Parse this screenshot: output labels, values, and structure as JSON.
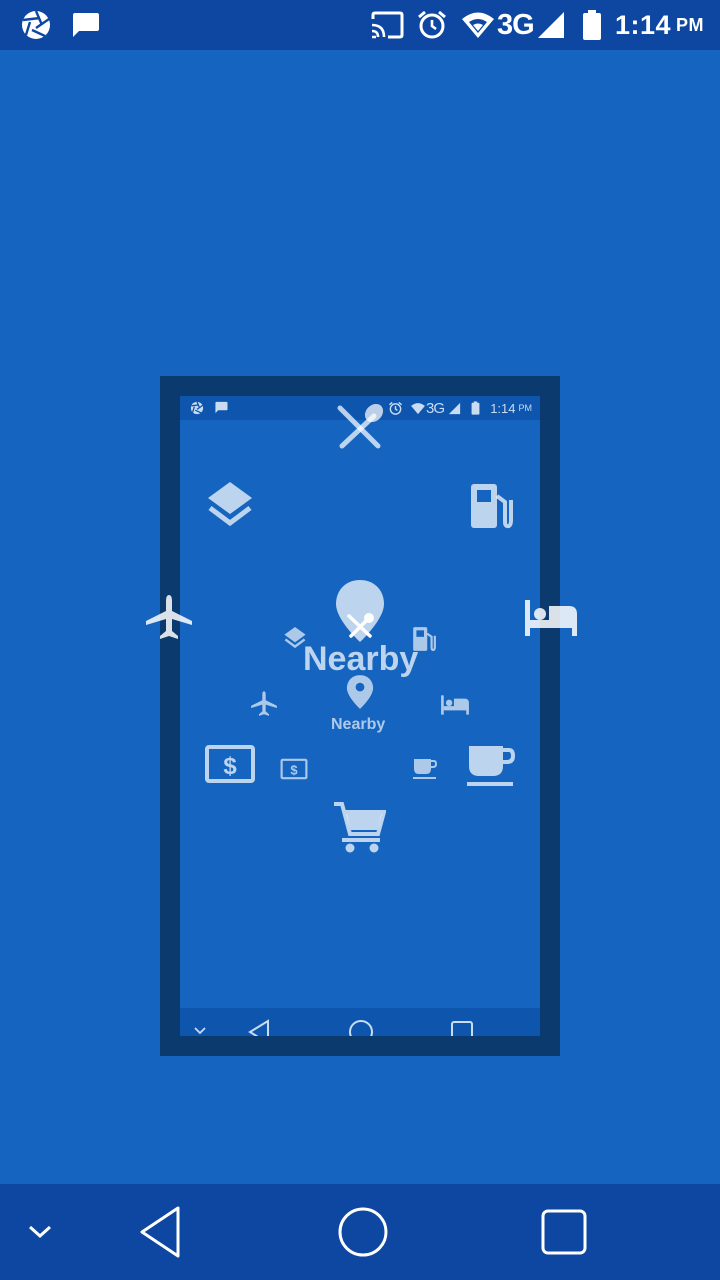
{
  "status_bar": {
    "time": "1:14",
    "ampm": "PM",
    "network": "3G"
  },
  "preview": {
    "mini_status": {
      "time": "1:14",
      "ampm": "PM",
      "network": "3G"
    },
    "title_large": "Nearby",
    "title_small": "Nearby"
  },
  "icons": [
    "aperture-icon",
    "chat-icon",
    "cast-icon",
    "alarm-icon",
    "wifi-icon",
    "signal-icon",
    "battery-icon",
    "restaurant-icon",
    "layers-icon",
    "gas-station-icon",
    "location-pin-icon",
    "airplane-icon",
    "hotel-bed-icon",
    "atm-dollar-icon",
    "coffee-cup-icon",
    "shopping-cart-icon"
  ],
  "colors": {
    "background": "#1565C0",
    "bars": "#0D47A1",
    "frame": "#0B3A6E"
  }
}
